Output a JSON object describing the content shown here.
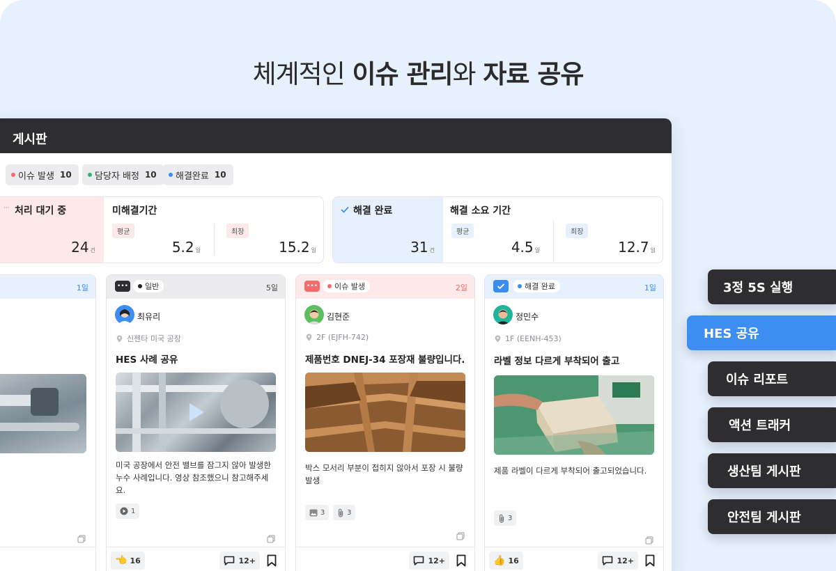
{
  "headline": {
    "part1": "체계적인 ",
    "bold1": "이슈 관리",
    "part2": "와 ",
    "bold2": "자료 공유"
  },
  "board": {
    "title": "게시판",
    "chips": [
      {
        "label": "이슈 발생",
        "count": "10",
        "color": "#f26b6b"
      },
      {
        "label": "담당자 배정",
        "count": "10",
        "color": "#2bb673"
      },
      {
        "label": "해결완료",
        "count": "10",
        "color": "#3b8cf0"
      }
    ],
    "pending": {
      "title": "처리 대기 중",
      "count": "24",
      "unit": "건"
    },
    "unresolved": {
      "title": "미해결기간",
      "avg_tag": "평균",
      "avg": "5.2",
      "max_tag": "최장",
      "max": "15.2",
      "unit": "일"
    },
    "resolved": {
      "title": "해결 완료",
      "count": "31",
      "unit": "건"
    },
    "resolve_time": {
      "title": "해결 소요 기간",
      "avg_tag": "평균",
      "avg": "4.5",
      "max_tag": "최장",
      "max": "12.7",
      "unit": "일"
    }
  },
  "cards": [
    {
      "days": "1일"
    },
    {
      "status": "일반",
      "days": "5일",
      "user": "최유리",
      "location": "신젠타 미국 공장",
      "title": "HES 사례 공유",
      "desc": "미국 공장에서 안전 밸브를 잠그지 않아 발생한 누수 사례입니다. 영상 참조했으니 참고해주세요.",
      "media": [
        {
          "icon": "play-icon",
          "count": "1"
        }
      ],
      "reaction": {
        "icon": "pointing-hand-icon",
        "count": "16"
      },
      "comments": "12+"
    },
    {
      "status": "이슈 발생",
      "days": "2일",
      "user": "김현준",
      "location": "2F (EJFH-742)",
      "title": "제품번호 DNEJ-34 포장재 불량입니다.",
      "desc": "박스 모서리 부분이 접히지 않아서 포장 시 불량 발생",
      "media": [
        {
          "icon": "image-icon",
          "count": "3"
        },
        {
          "icon": "paperclip-icon",
          "count": "3"
        }
      ],
      "comments": "12+"
    },
    {
      "status": "해결 완료",
      "days": "1일",
      "user": "정민수",
      "location": "1F (EENH-453)",
      "title": "라벨 정보 다르게 부착되어 출고",
      "desc": "제품 라벨이 다르게 부착되어 출고되었습니다.",
      "media": [
        {
          "icon": "paperclip-icon",
          "count": "3"
        }
      ],
      "reaction": {
        "icon": "thumbs-up-icon",
        "count": "16"
      },
      "comments": "12+"
    }
  ],
  "menu": [
    {
      "label": "3정 5S 실행",
      "active": false
    },
    {
      "label": "HES 공유",
      "active": true
    },
    {
      "label": "이슈 리포트",
      "active": false
    },
    {
      "label": "액션 트래커",
      "active": false
    },
    {
      "label": "생산팀 게시판",
      "active": false
    },
    {
      "label": "안전팀 게시판",
      "active": false
    }
  ],
  "colors": {
    "menu_dark": "#2e2e30",
    "menu_active": "#3d8df2",
    "issue_red": "#f26b6b",
    "resolved_blue": "#3b8cf0"
  }
}
